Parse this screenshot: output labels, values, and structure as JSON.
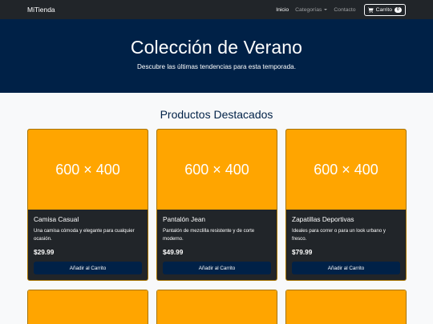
{
  "navbar": {
    "brand": "MiTienda",
    "links": [
      {
        "label": "Inicio",
        "active": true
      },
      {
        "label": "Categorías",
        "dropdown": true
      },
      {
        "label": "Contacto"
      }
    ],
    "cart": {
      "label": "Carrito",
      "count": "0",
      "icon": "cart-icon"
    }
  },
  "hero": {
    "title": "Colección de Verano",
    "subtitle": "Descubre las últimas tendencias para esta temporada."
  },
  "products_section": {
    "title": "Productos Destacados",
    "products": [
      {
        "image_placeholder": "600 × 400",
        "name": "Camisa Casual",
        "description": "Una camisa cómoda y elegante para cualquier ocasión.",
        "price": "$29.99",
        "button": "Añadir al Carrito"
      },
      {
        "image_placeholder": "600 × 400",
        "name": "Pantalón Jean",
        "description": "Pantalón de mezclilla resistente y de corte moderno.",
        "price": "$49.99",
        "button": "Añadir al Carrito"
      },
      {
        "image_placeholder": "600 × 400",
        "name": "Zapatillas Deportivas",
        "description": "Ideales para correr o para un look urbano y fresco.",
        "price": "$79.99",
        "button": "Añadir al Carrito"
      }
    ]
  },
  "colors": {
    "navbar_bg": "#212529",
    "hero_bg": "#002147",
    "placeholder_bg": "#ffa500",
    "button_bg": "#002147"
  }
}
